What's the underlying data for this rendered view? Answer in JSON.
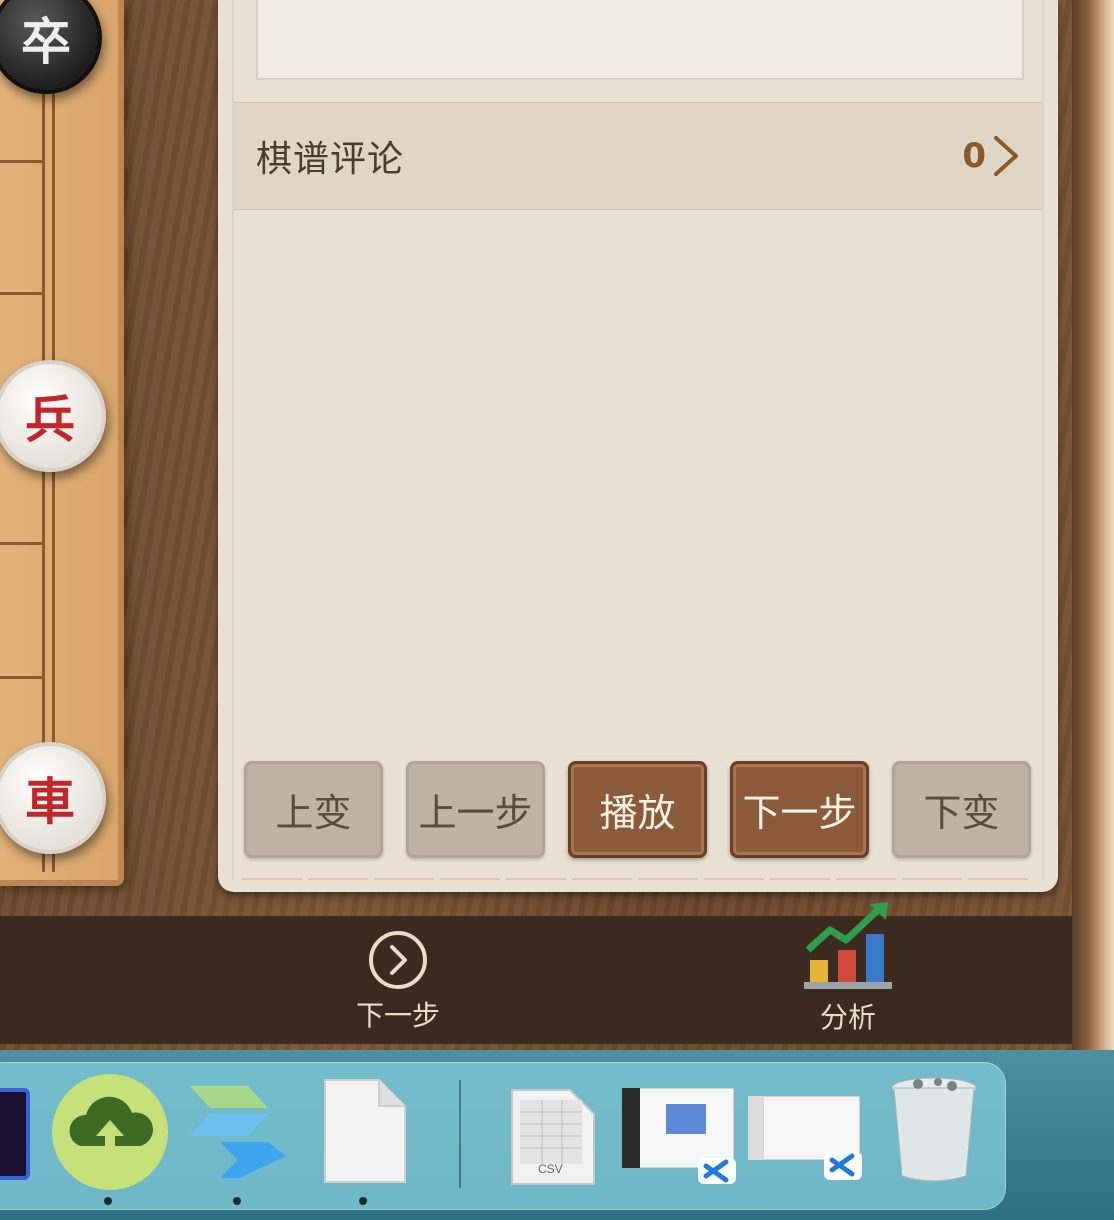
{
  "board": {
    "pieces": [
      {
        "name": "piece-zu",
        "text": "卒",
        "side": "black"
      },
      {
        "name": "piece-bing",
        "text": "兵",
        "side": "red"
      },
      {
        "name": "piece-ju",
        "text": "車",
        "side": "red"
      }
    ]
  },
  "panel": {
    "comments": {
      "title": "棋谱评论",
      "count": "0"
    },
    "controls": [
      {
        "label": "上变",
        "state": "disabled"
      },
      {
        "label": "上一步",
        "state": "disabled"
      },
      {
        "label": "播放",
        "state": "active"
      },
      {
        "label": "下一步",
        "state": "active"
      },
      {
        "label": "下变",
        "state": "disabled"
      }
    ]
  },
  "toolbar": {
    "next_label": "下一步",
    "analysis_label": "分析"
  },
  "dock": {
    "items": [
      {
        "name": "dock-app-dark-icon"
      },
      {
        "name": "dock-cloud-upload-app-icon",
        "running": true
      },
      {
        "name": "dock-chevron-app-icon",
        "running": true
      },
      {
        "name": "dock-blank-document-icon",
        "running": true
      },
      {
        "name": "dock-csv-file-icon",
        "text": "CSV"
      },
      {
        "name": "dock-vscode-window-1-icon"
      },
      {
        "name": "dock-vscode-window-2-icon"
      },
      {
        "name": "dock-trash-icon"
      }
    ]
  },
  "colors": {
    "active_button": "#8a5a3a",
    "disabled_button": "#bfb3a6",
    "panel_bg": "#e9e2d4",
    "red_piece_text": "#c0272d"
  }
}
